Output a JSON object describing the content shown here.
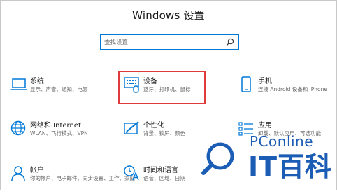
{
  "window": {
    "title": "Windows 设置"
  },
  "search": {
    "placeholder": "查找设置"
  },
  "tiles": [
    {
      "id": "system",
      "icon": "laptop-icon",
      "title": "系统",
      "desc": "显示、声音、通知、电源"
    },
    {
      "id": "devices",
      "icon": "keyboard-icon",
      "title": "设备",
      "desc": "蓝牙、打印机、鼠标",
      "highlighted": true
    },
    {
      "id": "phone",
      "icon": "phone-icon",
      "title": "手机",
      "desc": "连接 Android 设备和 iPhone"
    },
    {
      "id": "network",
      "icon": "globe-icon",
      "title": "网络和 Internet",
      "desc": "WLAN、飞行模式、VPN"
    },
    {
      "id": "personalization",
      "icon": "paintbrush-icon",
      "title": "个性化",
      "desc": "背景、锁屏、颜色"
    },
    {
      "id": "apps",
      "icon": "apps-list-icon",
      "title": "应用",
      "desc": "卸载、默认应用、可选功能"
    },
    {
      "id": "accounts",
      "icon": "person-icon",
      "title": "帐户",
      "desc": "你的帐户、电子邮件、同步设置、工作、家庭"
    },
    {
      "id": "time",
      "icon": "time-language-icon",
      "title": "时间和语言",
      "desc": "语音、区域、日期"
    }
  ],
  "watermark": {
    "brand": "PConline",
    "text": "IT百科"
  },
  "colors": {
    "accent": "#0078d7",
    "highlight": "#e03a3a",
    "watermark": "#1b5cb5"
  }
}
